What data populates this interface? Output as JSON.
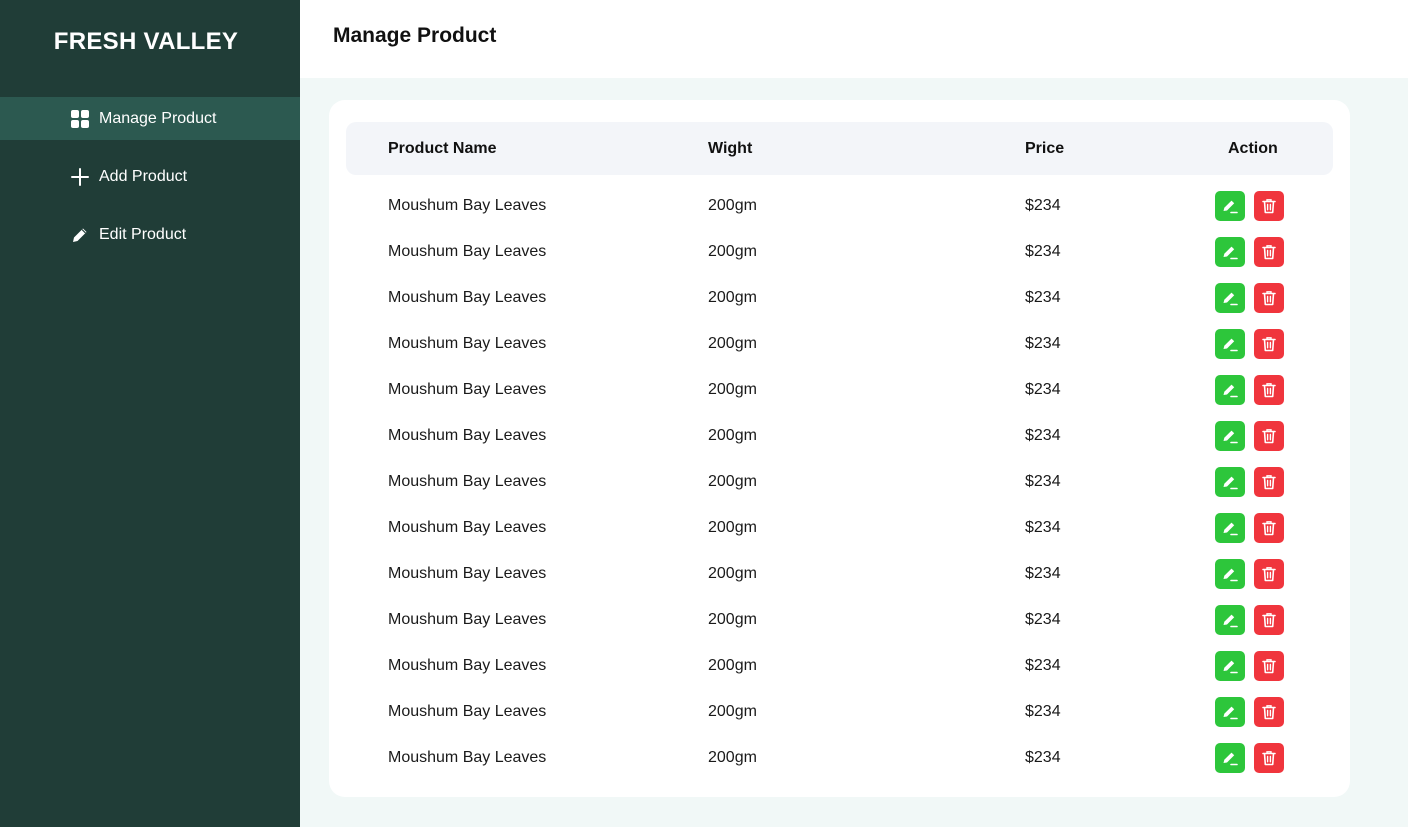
{
  "brand": "FRESH VALLEY",
  "sidebar": {
    "items": [
      {
        "label": "Manage Product",
        "icon": "grid-icon",
        "active": true
      },
      {
        "label": "Add Product",
        "icon": "plus-icon",
        "active": false
      },
      {
        "label": "Edit Product",
        "icon": "pencil-icon",
        "active": false
      }
    ]
  },
  "header": {
    "title": "Manage Product"
  },
  "table": {
    "columns": [
      "Product Name",
      "Wight",
      "Price",
      "Action"
    ],
    "rows": [
      {
        "name": "Moushum Bay Leaves",
        "weight": "200gm",
        "price": "$234"
      },
      {
        "name": "Moushum Bay Leaves",
        "weight": "200gm",
        "price": "$234"
      },
      {
        "name": "Moushum Bay Leaves",
        "weight": "200gm",
        "price": "$234"
      },
      {
        "name": "Moushum Bay Leaves",
        "weight": "200gm",
        "price": "$234"
      },
      {
        "name": "Moushum Bay Leaves",
        "weight": "200gm",
        "price": "$234"
      },
      {
        "name": "Moushum Bay Leaves",
        "weight": "200gm",
        "price": "$234"
      },
      {
        "name": "Moushum Bay Leaves",
        "weight": "200gm",
        "price": "$234"
      },
      {
        "name": "Moushum Bay Leaves",
        "weight": "200gm",
        "price": "$234"
      },
      {
        "name": "Moushum Bay Leaves",
        "weight": "200gm",
        "price": "$234"
      },
      {
        "name": "Moushum Bay Leaves",
        "weight": "200gm",
        "price": "$234"
      },
      {
        "name": "Moushum Bay Leaves",
        "weight": "200gm",
        "price": "$234"
      },
      {
        "name": "Moushum Bay Leaves",
        "weight": "200gm",
        "price": "$234"
      },
      {
        "name": "Moushum Bay Leaves",
        "weight": "200gm",
        "price": "$234"
      }
    ]
  },
  "colors": {
    "sidebar_bg": "#203d37",
    "sidebar_active": "#2c5950",
    "edit_button": "#2dc63b",
    "delete_button": "#f0353d",
    "content_bg": "#f1f8f7"
  }
}
